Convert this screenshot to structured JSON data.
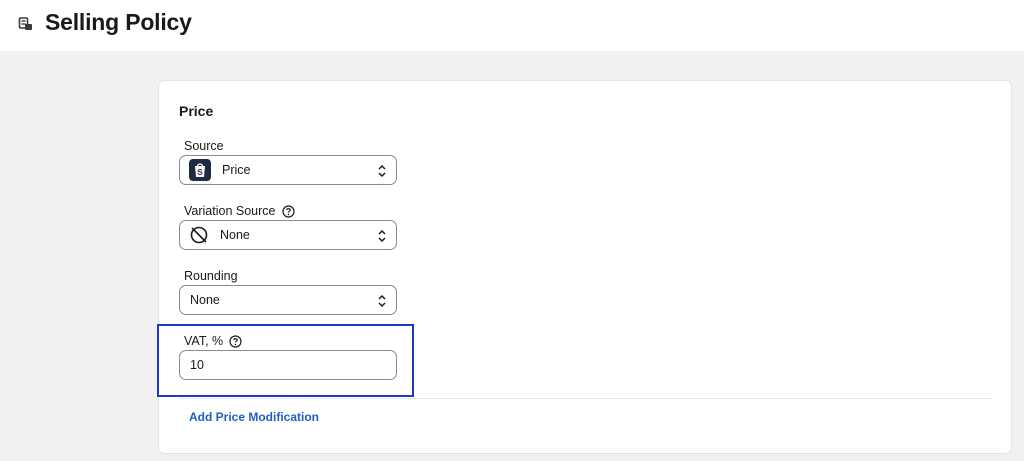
{
  "page": {
    "title": "Selling Policy",
    "title_icon": "policy-icon"
  },
  "price_section": {
    "heading": "Price",
    "source": {
      "label": "Source",
      "value": "Price",
      "icon": "shopify-bag-icon"
    },
    "variation_source": {
      "label": "Variation Source",
      "value": "None",
      "icon": "none-circle-slash-icon",
      "help_icon": "question-circle-icon"
    },
    "rounding": {
      "label": "Rounding",
      "value": "None"
    },
    "vat": {
      "label": "VAT, %",
      "value": "10",
      "help_icon": "question-circle-icon"
    },
    "add_modification_link": "Add Price Modification"
  },
  "colors": {
    "accent_link": "#1f5fbf",
    "highlight_border": "#1c3bbf",
    "page_background": "#f1f1f1"
  }
}
